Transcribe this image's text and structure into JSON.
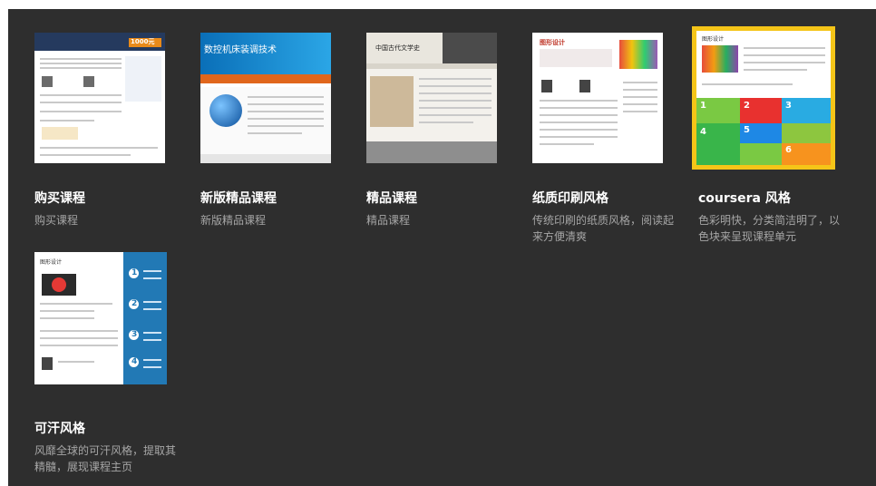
{
  "cards": [
    {
      "title": "购买课程",
      "desc": "购买课程",
      "thumb": {
        "price": "1000元"
      }
    },
    {
      "title": "新版精品课程",
      "desc": "新版精品课程",
      "thumb": {
        "banner": "数控机床装调技术"
      }
    },
    {
      "title": "精品课程",
      "desc": "精品课程",
      "thumb": {
        "banner": "中国古代文学史"
      }
    },
    {
      "title": "纸质印刷风格",
      "desc": "传统印刷的纸质风格，阅读起来方便清爽",
      "thumb": {
        "heading": "图形设计"
      }
    },
    {
      "title": "coursera 风格",
      "desc": "色彩明快，分类简洁明了，以色块来呈现课程单元",
      "thumb": {
        "heading": "图形设计",
        "tiles": [
          "1",
          "2",
          "3",
          "4",
          "5",
          "6"
        ]
      }
    },
    {
      "title": "可汗风格",
      "desc": "风靡全球的可汗风格，提取其精髓，展现课程主页",
      "thumb": {
        "heading": "图形设计",
        "steps": [
          "1",
          "2",
          "3",
          "4"
        ]
      }
    }
  ],
  "colors": {
    "background": "#2e2e2e",
    "selected_border": "#f5c518",
    "title": "#ffffff",
    "desc": "#a6a6a6"
  }
}
